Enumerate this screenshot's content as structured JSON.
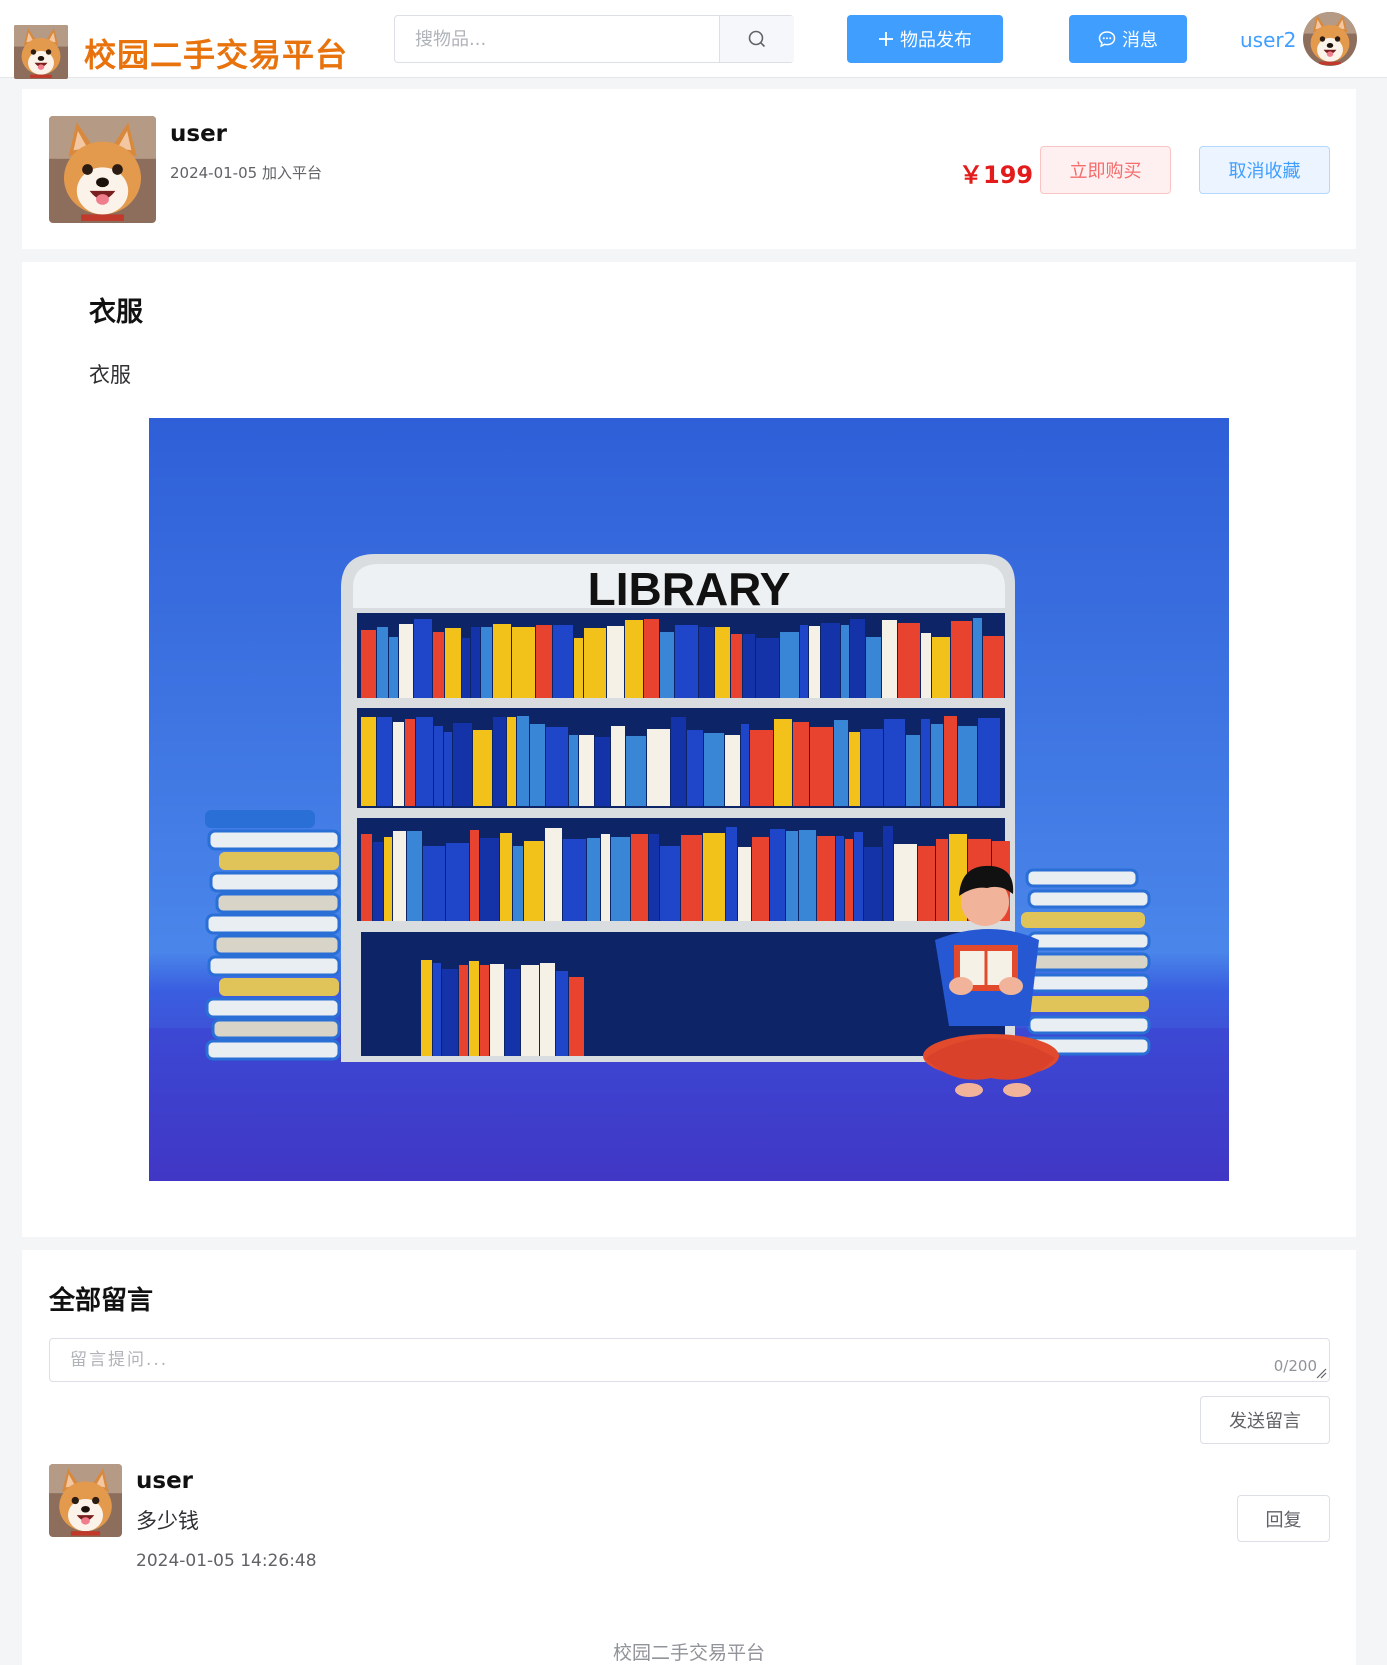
{
  "header": {
    "site_title": "校园二手交易平台",
    "search_placeholder": "搜物品...",
    "publish_label": "物品发布",
    "messages_label": "消息",
    "username": "user2"
  },
  "seller": {
    "name": "user",
    "joined": "2024-01-05 加入平台",
    "price": "￥199",
    "buy_label": "立即购买",
    "unfavorite_label": "取消收藏"
  },
  "item": {
    "title": "衣服",
    "description": "衣服",
    "image_text": "LIBRARY"
  },
  "comments": {
    "heading": "全部留言",
    "input_placeholder": "留言提问...",
    "char_count": "0/200",
    "send_label": "发送留言",
    "reply_label": "回复",
    "items": [
      {
        "name": "user",
        "text": "多少钱",
        "time": "2024-01-05 14:26:48"
      }
    ]
  },
  "footer": {
    "text": "校园二手交易平台"
  },
  "colors": {
    "brand": "#e8720c",
    "primary": "#409eff",
    "price": "#e31b1b"
  }
}
